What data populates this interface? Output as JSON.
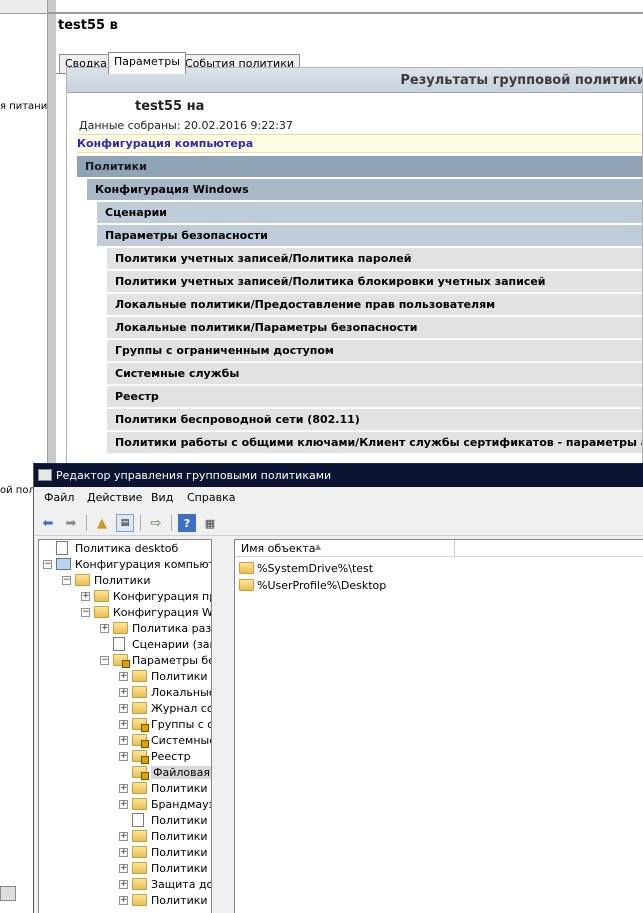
{
  "bg_window": {
    "cut_labels": [
      "я питани",
      "ой поли"
    ]
  },
  "gpo_window": {
    "title": "test55 в",
    "tabs": [
      "Сводка",
      "Параметры",
      "События политики"
    ],
    "active_tab": 1,
    "report": {
      "banner": "Результаты групповой политики",
      "host": "test55 на",
      "collected": "Данные собраны: 20.02.2016 9:22:37",
      "computer_config": "Конфигурация компьютера",
      "sections": [
        {
          "level": 0,
          "label": "Политики"
        },
        {
          "level": 1,
          "label": "Конфигурация Windows"
        },
        {
          "level": 2,
          "label": "Сценарии"
        },
        {
          "level": 2,
          "label": "Параметры безопасности"
        },
        {
          "level": 3,
          "label": "Политики учетных записей/Политика паролей"
        },
        {
          "level": 3,
          "label": "Политики учетных записей/Политика блокировки учетных записей"
        },
        {
          "level": 3,
          "label": "Локальные политики/Предоставление прав пользователям"
        },
        {
          "level": 3,
          "label": "Локальные политики/Параметры безопасности"
        },
        {
          "level": 3,
          "label": "Группы с ограниченным доступом"
        },
        {
          "level": 3,
          "label": "Системные службы"
        },
        {
          "level": 3,
          "label": "Реестр"
        },
        {
          "level": 3,
          "label": "Политики беспроводной сети (802.11)"
        },
        {
          "level": 3,
          "label": "Политики работы с общими ключами/Клиент службы сертификатов - параметры автом"
        }
      ]
    }
  },
  "gpme_window": {
    "title": "Редактор управления групповыми политиками",
    "menu": [
      "Файл",
      "Действие",
      "Вид",
      "Справка"
    ],
    "toolbar_icons": [
      "back-arrow-icon",
      "forward-arrow-icon",
      "up-folder-icon",
      "show-tree-icon",
      "export-list-icon",
      "help-icon",
      "properties-icon"
    ],
    "tree": [
      {
        "indent": 0,
        "icon": "doc",
        "label": "Политика desktoб",
        "expander": ""
      },
      {
        "indent": 0,
        "icon": "pc",
        "label": "Конфигурация компьютер",
        "expander": "-"
      },
      {
        "indent": 1,
        "icon": "folder",
        "label": "Политики",
        "expander": "-"
      },
      {
        "indent": 2,
        "icon": "folder",
        "label": "Конфигурация про",
        "expander": "+"
      },
      {
        "indent": 2,
        "icon": "folder",
        "label": "Конфигурация Win",
        "expander": "-"
      },
      {
        "indent": 3,
        "icon": "folder",
        "label": "Политика разр",
        "expander": "+"
      },
      {
        "indent": 3,
        "icon": "doc",
        "label": "Сценарии (зап",
        "expander": ""
      },
      {
        "indent": 3,
        "icon": "folder-lock",
        "label": "Параметры без",
        "expander": "-"
      },
      {
        "indent": 4,
        "icon": "folder",
        "label": "Политики у",
        "expander": "+"
      },
      {
        "indent": 4,
        "icon": "folder",
        "label": "Локальные",
        "expander": "+"
      },
      {
        "indent": 4,
        "icon": "folder",
        "label": "Журнал со",
        "expander": "+"
      },
      {
        "indent": 4,
        "icon": "folder-lock",
        "label": "Группы с о",
        "expander": "+"
      },
      {
        "indent": 4,
        "icon": "folder-lock",
        "label": "Системные",
        "expander": "+"
      },
      {
        "indent": 4,
        "icon": "folder-lock",
        "label": "Реестр",
        "expander": "+"
      },
      {
        "indent": 4,
        "icon": "folder-lock",
        "label": "Файловая с",
        "expander": "",
        "selected": true
      },
      {
        "indent": 4,
        "icon": "folder",
        "label": "Политики п",
        "expander": "+"
      },
      {
        "indent": 4,
        "icon": "folder",
        "label": "Брандмауэр",
        "expander": "+"
      },
      {
        "indent": 4,
        "icon": "doc",
        "label": "Политики д",
        "expander": ""
      },
      {
        "indent": 4,
        "icon": "folder",
        "label": "Политики б",
        "expander": "+"
      },
      {
        "indent": 4,
        "icon": "folder",
        "label": "Политики с",
        "expander": "+"
      },
      {
        "indent": 4,
        "icon": "folder",
        "label": "Политики о",
        "expander": "+"
      },
      {
        "indent": 4,
        "icon": "folder",
        "label": "Защита до",
        "expander": "+"
      },
      {
        "indent": 4,
        "icon": "folder",
        "label": "Политики у",
        "expander": "+"
      }
    ],
    "list": {
      "column": "Имя объекта",
      "items": [
        "%SystemDrive%\\test",
        "%UserProfile%\\Desktop"
      ]
    }
  }
}
